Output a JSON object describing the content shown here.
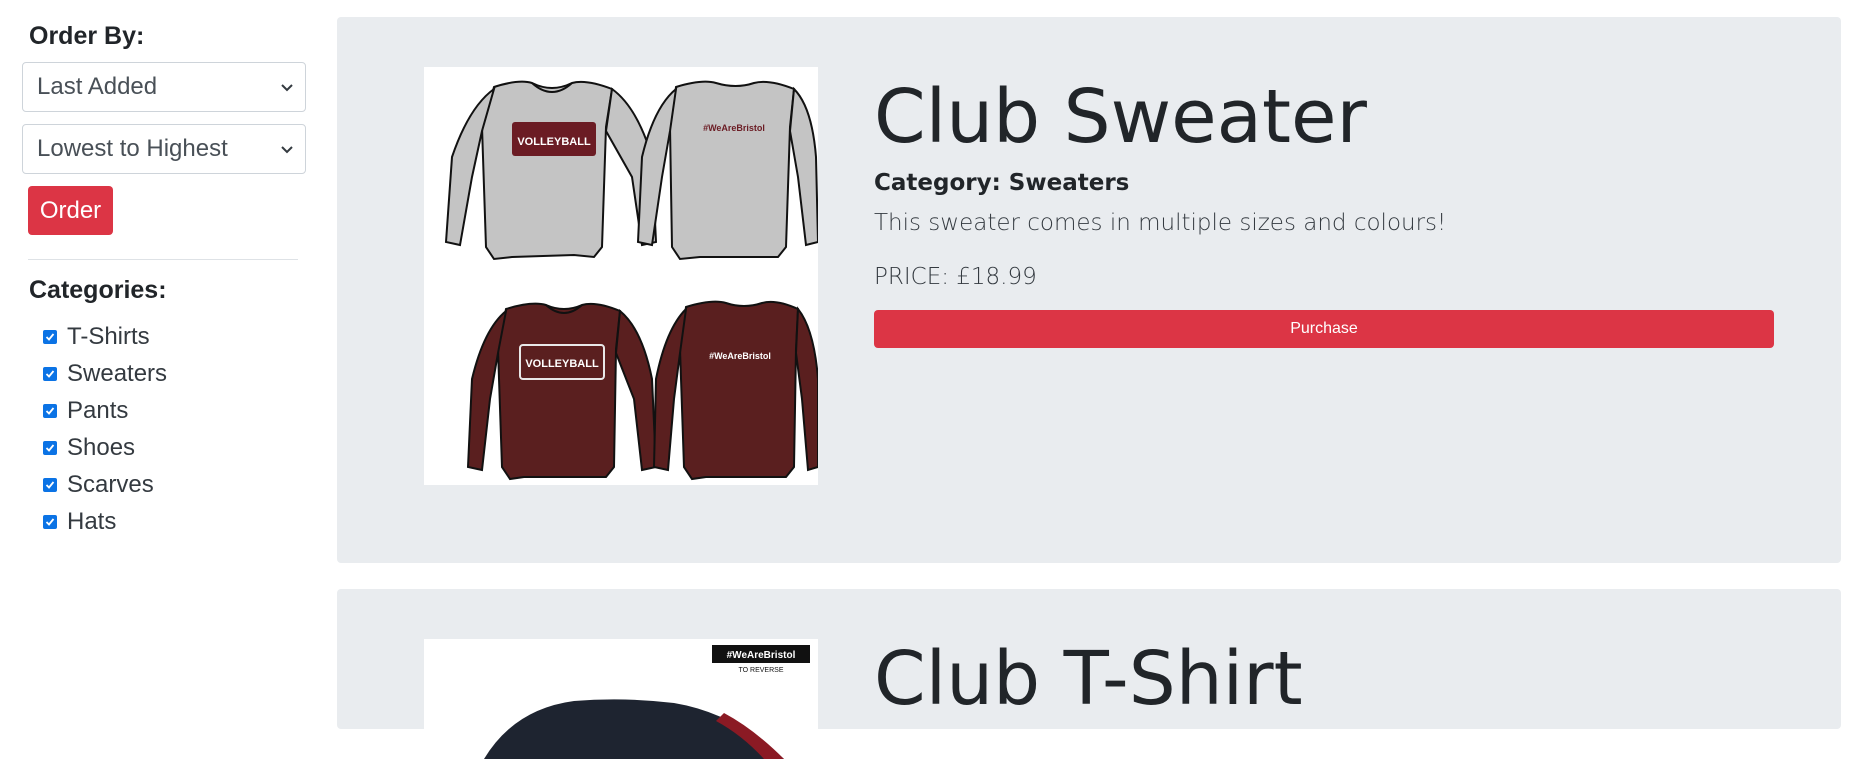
{
  "sidebar": {
    "order_heading": "Order By:",
    "sort_field": "Last Added",
    "sort_direction": "Lowest to Highest",
    "order_button": "Order",
    "categories_heading": "Categories:",
    "categories": [
      {
        "label": "T-Shirts",
        "checked": true
      },
      {
        "label": "Sweaters",
        "checked": true
      },
      {
        "label": "Pants",
        "checked": true
      },
      {
        "label": "Shoes",
        "checked": true
      },
      {
        "label": "Scarves",
        "checked": true
      },
      {
        "label": "Hats",
        "checked": true
      }
    ]
  },
  "products": [
    {
      "title": "Club Sweater",
      "category": "Category: Sweaters",
      "description": "This sweater comes in multiple sizes and colours!",
      "price": "PRICE: £18.99",
      "button": "Purchase",
      "image_text": {
        "front": "VOLLEYBALL",
        "back": "#WeAreBristol"
      }
    },
    {
      "title": "Club T-Shirt",
      "image_text": {
        "tag": "#WeAreBristol",
        "tag_sub": "TO REVERSE"
      }
    }
  ],
  "colors": {
    "accent": "#dc3545",
    "card_bg": "#e9ecef",
    "checkbox": "#0b73e5",
    "sweater_grey": "#c4c4c4",
    "sweater_maroon": "#5a1f1f"
  }
}
